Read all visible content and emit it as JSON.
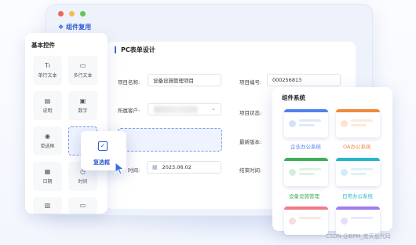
{
  "window": {
    "tab_label": "组件复用"
  },
  "left_panel": {
    "title": "基本控件",
    "tiles": [
      {
        "label": "单行文本",
        "icon": "single-text-icon",
        "glyph": "Tı"
      },
      {
        "label": "多行文本",
        "icon": "multi-text-icon",
        "glyph": "▭"
      },
      {
        "label": "说明",
        "icon": "description-icon",
        "glyph": "▤"
      },
      {
        "label": "数字",
        "icon": "number-icon",
        "glyph": "▣"
      },
      {
        "label": "单选框",
        "icon": "radio-icon",
        "glyph": "◉"
      },
      {
        "label": "日期",
        "icon": "date-icon",
        "glyph": "▦"
      },
      {
        "label": "时间",
        "icon": "time-icon",
        "glyph": "◷"
      }
    ],
    "dragged": {
      "label": "复选框",
      "glyph": "✓"
    }
  },
  "form": {
    "title": "PC表单设计",
    "fields": {
      "project_name_label": "项目名称:",
      "project_name_value": "设备设施管理项目",
      "project_no_label": "项目编号:",
      "project_no_value": "000256813",
      "customer_label": "所属客户:",
      "project_status_label": "项目状态:",
      "latest_version_label": "最新版本:",
      "time_label": "时间:",
      "time_value": "2023.06.02",
      "end_time_label": "结束时间:"
    }
  },
  "right_panel": {
    "title": "组件系统",
    "cards": [
      {
        "label": "企业办公系统",
        "color": "#4f83ef"
      },
      {
        "label": "OA办公系统",
        "color": "#f08a3c"
      },
      {
        "label": "设备设施管理",
        "color": "#3fae5a"
      },
      {
        "label": "日常办公系统",
        "color": "#27b5c9"
      },
      {
        "label": "",
        "color": "#f07a86"
      },
      {
        "label": "",
        "color": "#a07cf0"
      }
    ]
  },
  "watermark": "CSDN @BPM_宏天低代码"
}
